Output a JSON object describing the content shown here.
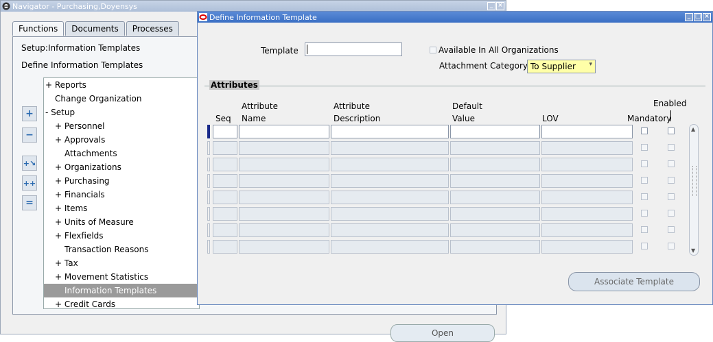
{
  "navigator": {
    "title": "Navigator - Purchasing,Doyensys",
    "tabs": [
      "Functions",
      "Documents",
      "Processes"
    ],
    "breadcrumb": "Setup:Information Templates",
    "subtitle": "Define Information Templates",
    "tree": [
      {
        "label": "+ Reports",
        "indent": 1
      },
      {
        "label": "Change Organization",
        "indent": 2
      },
      {
        "label": "- Setup",
        "indent": 1
      },
      {
        "label": "+ Personnel",
        "indent": 2
      },
      {
        "label": "+ Approvals",
        "indent": 2
      },
      {
        "label": "Attachments",
        "indent": 3
      },
      {
        "label": "+ Organizations",
        "indent": 2
      },
      {
        "label": "+ Purchasing",
        "indent": 2
      },
      {
        "label": "+ Financials",
        "indent": 2
      },
      {
        "label": "+ Items",
        "indent": 2
      },
      {
        "label": "+ Units of Measure",
        "indent": 2
      },
      {
        "label": "+ Flexfields",
        "indent": 2
      },
      {
        "label": "Transaction Reasons",
        "indent": 3
      },
      {
        "label": "+ Tax",
        "indent": 2
      },
      {
        "label": "+ Movement Statistics",
        "indent": 2
      },
      {
        "label": "Information Templates",
        "indent": 3,
        "selected": true
      },
      {
        "label": "+ Credit Cards",
        "indent": 2
      }
    ],
    "open_label": "Open"
  },
  "dialog": {
    "title": "Define Information Template",
    "template_label": "Template",
    "template_value": "",
    "available_label": "Available In All Organizations",
    "attachment_category_label": "Attachment Category",
    "attachment_category_value": "To Supplier",
    "section_title": "Attributes",
    "columns": {
      "seq": "Seq",
      "attr_name_1": "Attribute",
      "attr_name_2": "Name",
      "attr_desc_1": "Attribute",
      "attr_desc_2": "Description",
      "default_1": "Default",
      "default_2": "Value",
      "lov": "LOV",
      "mandatory": "Mandatory",
      "enabled": "Enabled"
    },
    "row_count": 8,
    "associate_label": "Associate Template"
  }
}
